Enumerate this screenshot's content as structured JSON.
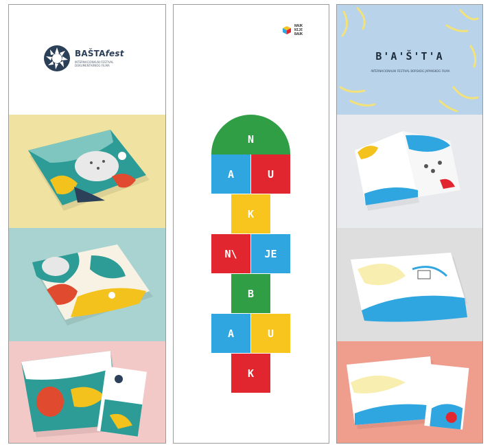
{
  "panel1": {
    "logo": {
      "word": "BAŠTA",
      "word_suffix": "fest",
      "sub": "INTERNACIONALNI FESTIVAL DOKUMENTARNOG FILMA"
    },
    "icon": "basta-aperture-logo",
    "bands": [
      {
        "name": "folded-map-mockup-1",
        "color": "#f0e2a1"
      },
      {
        "name": "folded-map-mockup-2",
        "color": "#a9d3d0"
      },
      {
        "name": "folded-map-mockup-3",
        "color": "#f3c9c8"
      }
    ]
  },
  "panel2": {
    "logo_text": [
      "NAUK",
      "NIJE",
      "BAUK"
    ],
    "hopscotch": {
      "arch": "N",
      "row2_left": "A",
      "row2_right": "U",
      "row3": "K",
      "row4_left": "N\\",
      "row4_right": "JE",
      "row5": "B",
      "row6_left": "A",
      "row6_right": "U",
      "row7": "K"
    },
    "colors": {
      "green": "#2f9e44",
      "blue": "#2fa6e0",
      "red": "#e2262f",
      "yellow": "#f7c51e"
    }
  },
  "panel3": {
    "title": "B'A'Š'T'A",
    "sub": "INTERNACIONALNI FESTIVAL BORSKOG JAPANSKOG FILMA",
    "bands": [
      {
        "name": "brochure-mockup-1",
        "color": "#e9eaee"
      },
      {
        "name": "brochure-mockup-2",
        "color": "#dedede"
      },
      {
        "name": "brochure-mockup-3",
        "color": "#ef9d8c"
      }
    ]
  }
}
